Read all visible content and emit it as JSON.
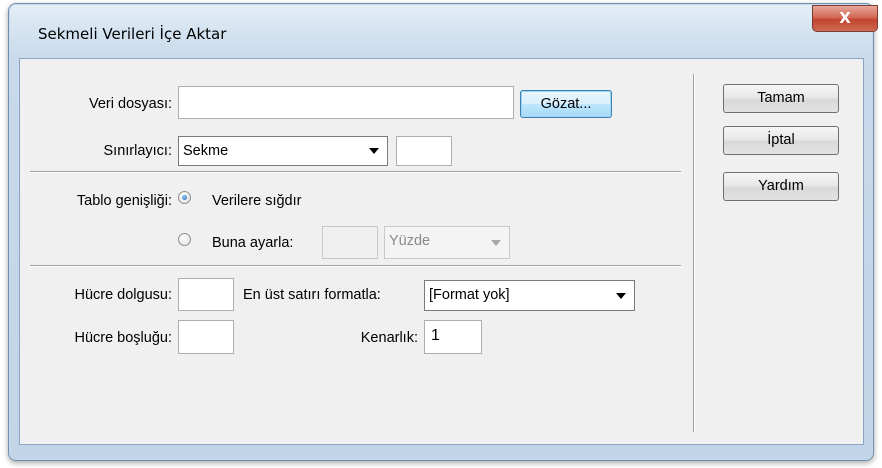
{
  "window": {
    "title": "Sekmeli Verileri İçe Aktar",
    "close_glyph": "X"
  },
  "form": {
    "data_file_label": "Veri dosyası:",
    "data_file_value": "",
    "browse_label": "Gözat...",
    "delimiter_label": "Sınırlayıcı:",
    "delimiter_value": "Sekme",
    "delimiter_other_value": "",
    "table_width_label": "Tablo genişliği:",
    "fit_to_data_label": "Verilere sığdır",
    "set_to_label": "Buna ayarla:",
    "set_to_value": "",
    "set_to_unit": "Yüzde",
    "cell_padding_label": "Hücre dolgusu:",
    "cell_padding_value": "",
    "format_top_row_label": "En üst satırı formatla:",
    "format_top_row_value": "[Format yok]",
    "cell_spacing_label": "Hücre boşluğu:",
    "cell_spacing_value": "",
    "border_label": "Kenarlık:",
    "border_value": "1"
  },
  "buttons": {
    "ok": "Tamam",
    "cancel": "İptal",
    "help": "Yardım"
  }
}
